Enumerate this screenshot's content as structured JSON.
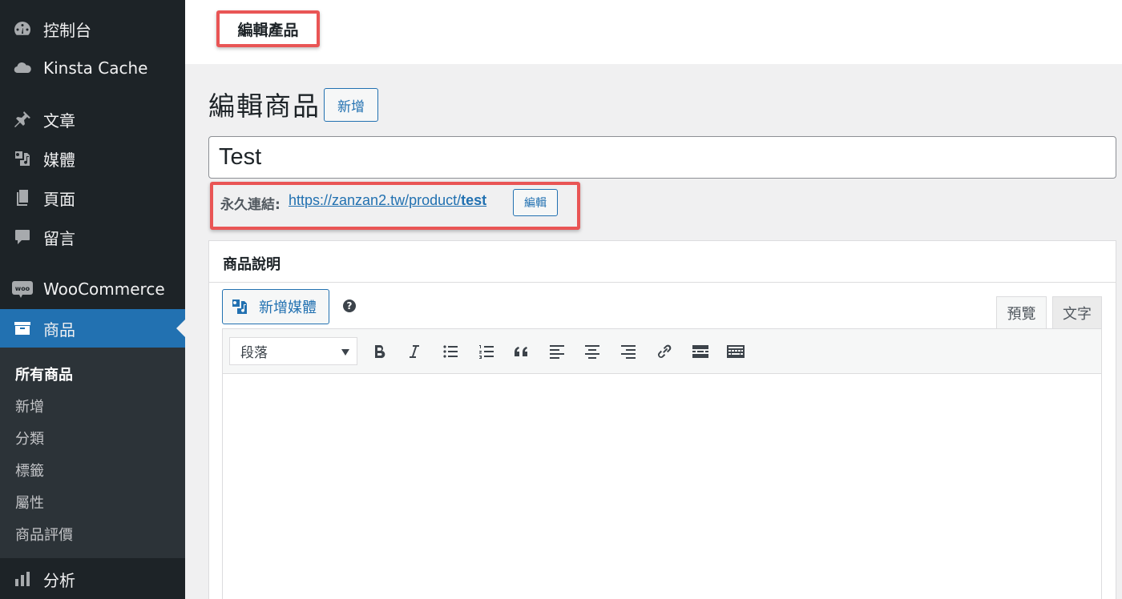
{
  "sidebar": {
    "items": [
      {
        "label": "控制台",
        "icon": "dashboard-icon"
      },
      {
        "label": "Kinsta Cache",
        "icon": "cloud-icon"
      },
      {
        "label": "文章",
        "icon": "pin-icon"
      },
      {
        "label": "媒體",
        "icon": "media-icon"
      },
      {
        "label": "頁面",
        "icon": "pages-icon"
      },
      {
        "label": "留言",
        "icon": "comments-icon"
      },
      {
        "label": "WooCommerce",
        "icon": "woo-icon"
      },
      {
        "label": "商品",
        "icon": "archive-icon",
        "active": true
      },
      {
        "label": "分析",
        "icon": "chart-bar-icon"
      }
    ],
    "submenu": [
      "所有商品",
      "新增",
      "分類",
      "標籤",
      "屬性",
      "商品評價"
    ],
    "submenu_current": "所有商品"
  },
  "breadcrumb": {
    "label": "編輯產品"
  },
  "header": {
    "title": "編輯商品",
    "add_new_label": "新增"
  },
  "title_field": {
    "value": "Test"
  },
  "permalink": {
    "label": "永久連結:",
    "url_base": "https://zanzan2.tw/product/",
    "slug": "test",
    "edit_label": "編輯"
  },
  "description_box": {
    "title": "商品說明",
    "add_media_label": "新增媒體",
    "help_glyph": "?",
    "tabs": [
      "預覽",
      "文字"
    ],
    "format_select": "段落",
    "toolbar_icons": [
      "bold-icon",
      "italic-icon",
      "bullet-list-icon",
      "numbered-list-icon",
      "blockquote-icon",
      "align-left-icon",
      "align-center-icon",
      "align-right-icon",
      "link-icon",
      "read-more-icon",
      "toolbar-toggle-icon"
    ]
  },
  "colors": {
    "sidebar_bg": "#1d2327",
    "submenu_bg": "#2c3338",
    "accent": "#2271b1",
    "highlight_border": "#e95555"
  }
}
